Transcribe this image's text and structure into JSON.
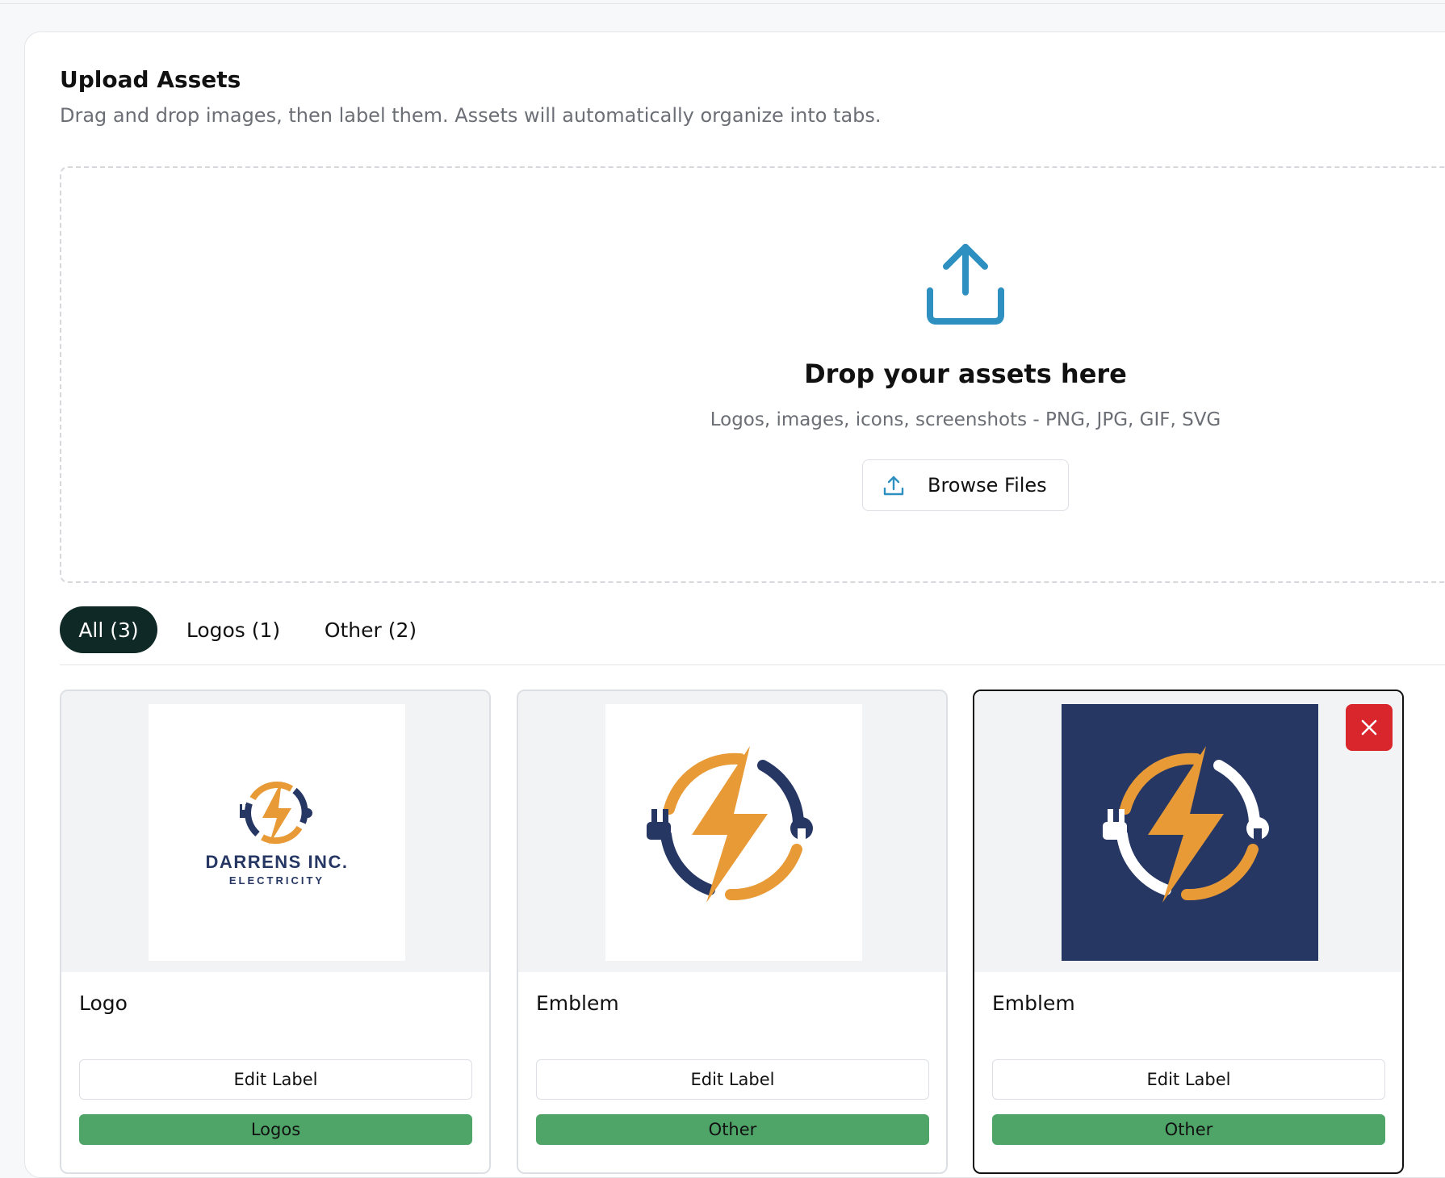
{
  "header": {
    "title": "Upload Assets",
    "subtitle": "Drag and drop images, then label them. Assets will automatically organize into tabs."
  },
  "dropzone": {
    "title": "Drop your assets here",
    "hint": "Logos, images, icons, screenshots - PNG, JPG, GIF, SVG",
    "browse_label": "Browse Files",
    "icon": "upload-icon"
  },
  "tabs": [
    {
      "label": "All (3)",
      "active": true
    },
    {
      "label": "Logos (1)",
      "active": false
    },
    {
      "label": "Other (2)",
      "active": false
    }
  ],
  "cards": [
    {
      "name": "Logo",
      "edit_label": "Edit Label",
      "tag": "Logos",
      "thumb": {
        "company": "DARRENS INC.",
        "tagline": "ELECTRICITY"
      }
    },
    {
      "name": "Emblem",
      "edit_label": "Edit Label",
      "tag": "Other"
    },
    {
      "name": "Emblem",
      "edit_label": "Edit Label",
      "tag": "Other",
      "selected": true
    }
  ],
  "colors": {
    "accent_blue": "#2e90c0",
    "tab_active_bg": "#0f2a26",
    "tag_green": "#4fa568",
    "remove_red": "#d9262c",
    "logo_orange": "#e89a36",
    "logo_navy": "#263764"
  }
}
